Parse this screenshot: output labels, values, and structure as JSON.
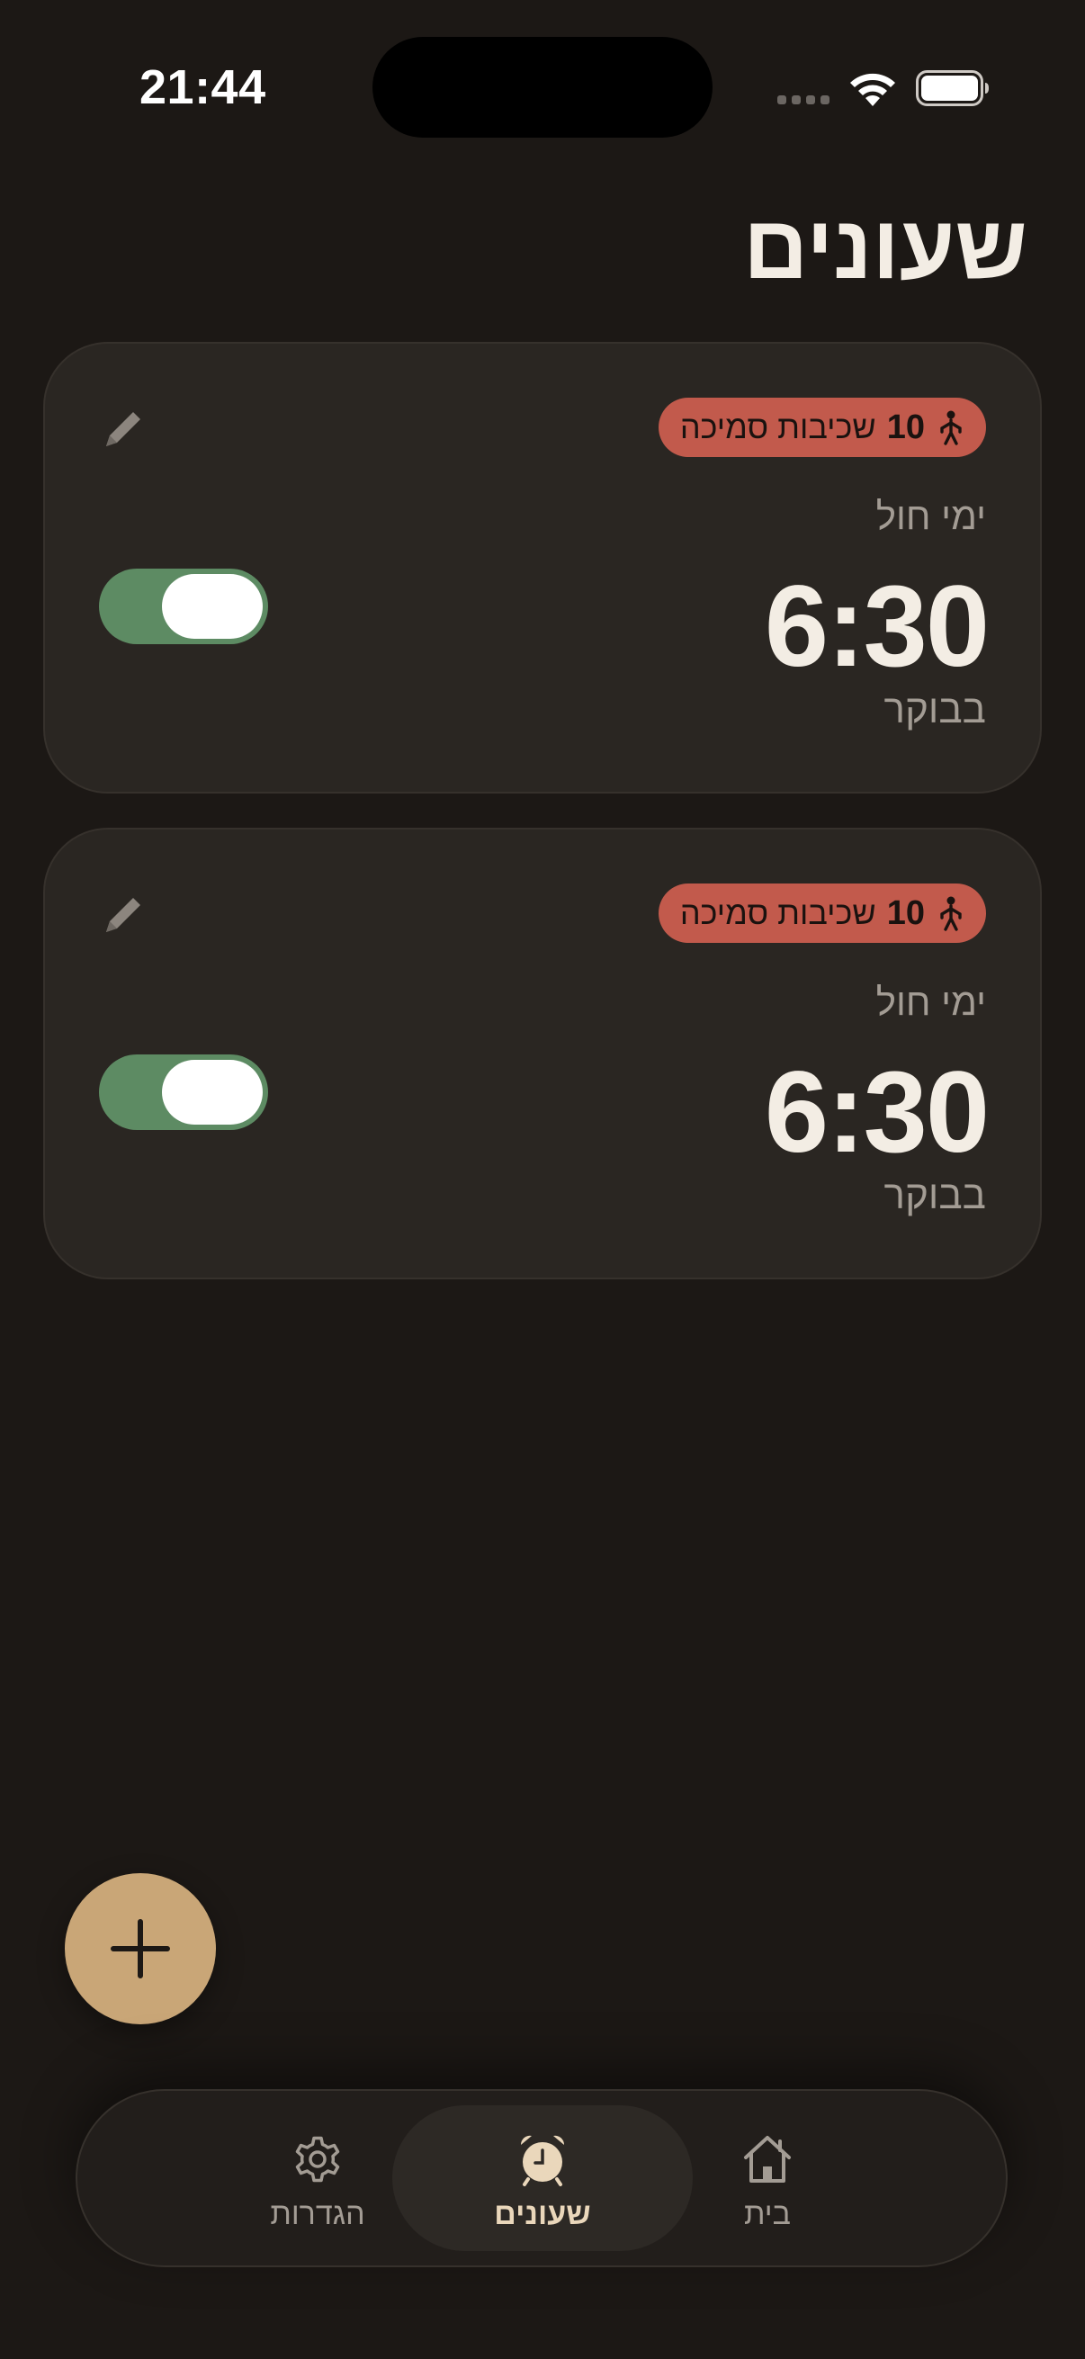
{
  "status_bar": {
    "time": "21:44"
  },
  "header": {
    "title": "שעונים"
  },
  "alarms": [
    {
      "badge_count": "10",
      "badge_label": "שכיבות סמיכה",
      "days": "ימי חול",
      "time": "6:30",
      "period": "בבוקר",
      "enabled": true
    },
    {
      "badge_count": "10",
      "badge_label": "שכיבות סמיכה",
      "days": "ימי חול",
      "time": "6:30",
      "period": "בבוקר",
      "enabled": true
    }
  ],
  "tabs": {
    "settings": "הגדרות",
    "alarms": "שעונים",
    "home": "בית"
  },
  "colors": {
    "background": "#1c1815",
    "card": "#2a2622",
    "badge": "#c25a4c",
    "toggle_on": "#5d8b63",
    "fab": "#c9a677",
    "active_tab_text": "#ead7bb"
  },
  "icons": {
    "badge": "person-exercise-icon",
    "edit": "pencil-icon",
    "add": "plus-icon",
    "settings": "gear-icon",
    "alarms": "alarm-clock-icon",
    "home": "house-icon"
  }
}
